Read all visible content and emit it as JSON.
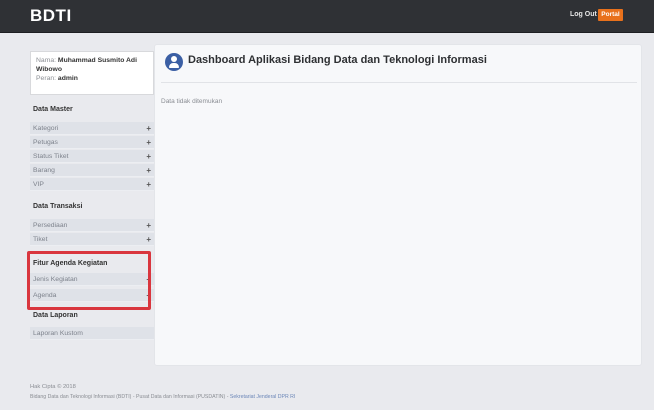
{
  "header": {
    "brand": "BDTI",
    "logout_label": "Log Out",
    "portal_label": "Portal"
  },
  "user": {
    "name_label": "Nama:",
    "name_value": "Muhammad Susmito Adi Wibowo",
    "role_label": "Peran:",
    "role_value": "admin"
  },
  "sidebar": {
    "sections": [
      {
        "title": "Data Master",
        "items": [
          "Kategori",
          "Petugas",
          "Status Tiket",
          "Barang",
          "VIP"
        ]
      },
      {
        "title": "Data Transaksi",
        "items": [
          "Persediaan",
          "Tiket"
        ]
      },
      {
        "title": "Fitur Agenda Kegiatan",
        "items": [
          "Jenis Kegiatan",
          "Agenda"
        ]
      },
      {
        "title": "Data Laporan",
        "items": [
          "Laporan Kustom"
        ]
      }
    ],
    "expand_icon": "+"
  },
  "main": {
    "title": "Dashboard Aplikasi Bidang Data dan Teknologi Informasi",
    "empty_message": "Data tidak ditemukan"
  },
  "footer": {
    "copyright": "Hak Cipta © 2018",
    "org_text": "Bidang Data dan Teknologi Informasi (BDTI) - Pusat Data dan Informasi (PUSDATIN) -",
    "org_link": "Sekretariat Jenderal DPR RI"
  },
  "colors": {
    "topbar": "#2f3135",
    "portal_button": "#e8711c",
    "highlight_box": "#d9363e",
    "user_icon": "#3b5fa4"
  }
}
